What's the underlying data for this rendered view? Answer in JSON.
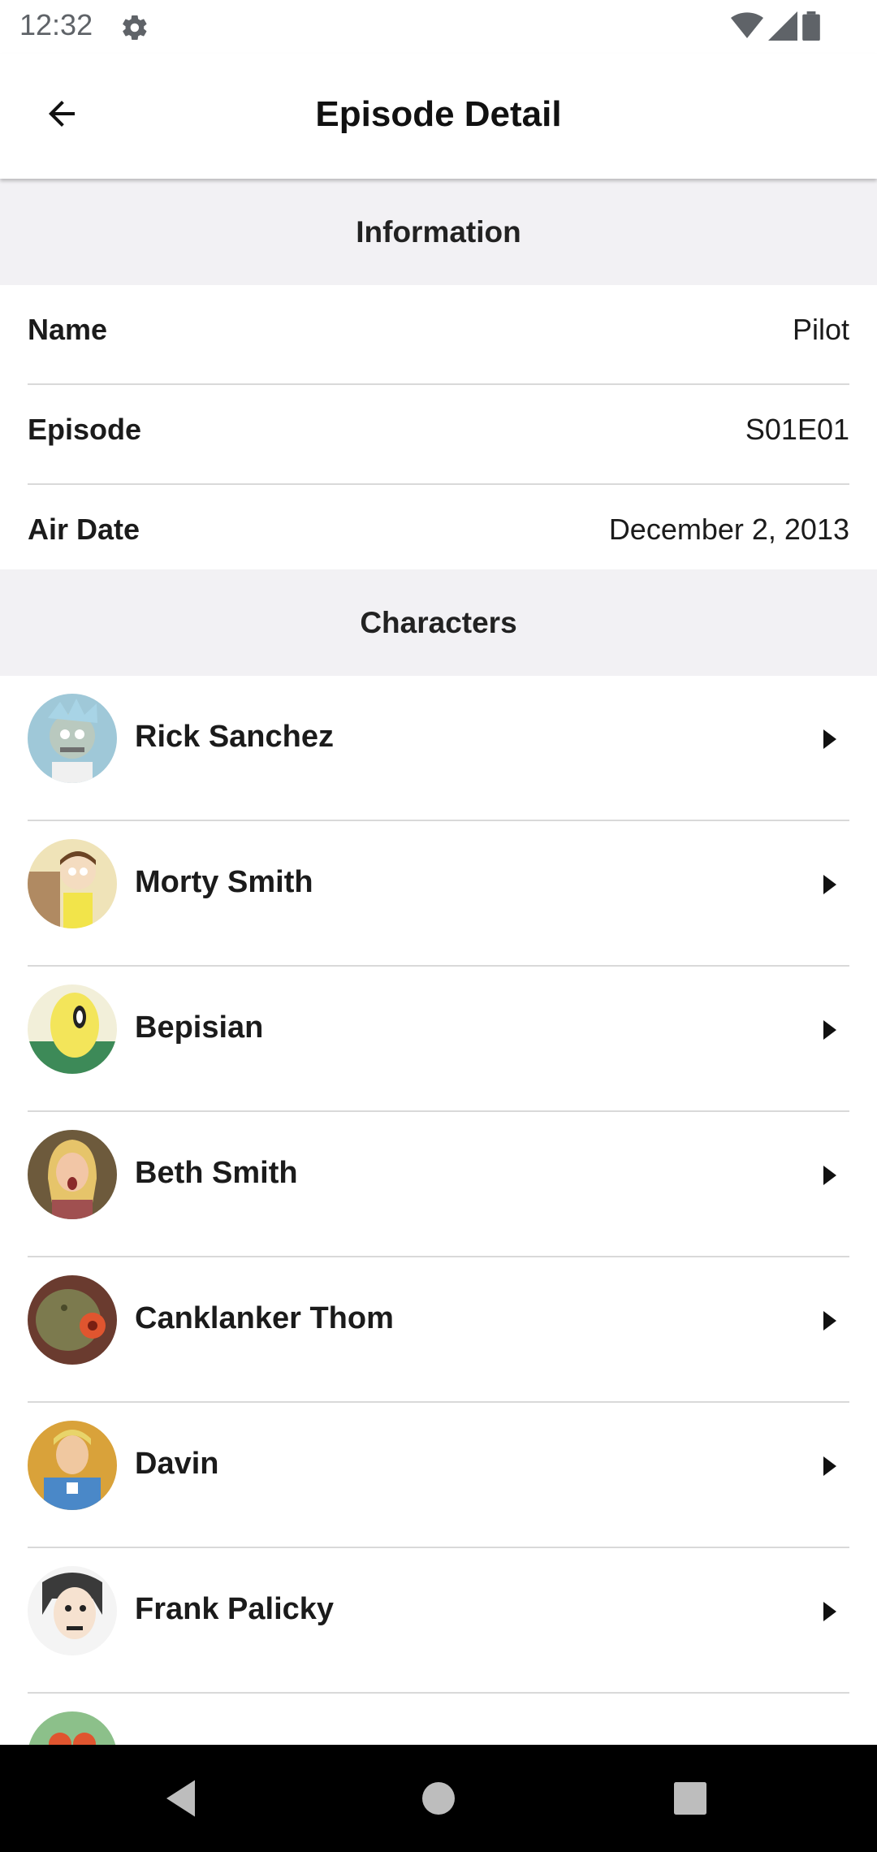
{
  "status": {
    "time": "12:32"
  },
  "appbar": {
    "title": "Episode Detail"
  },
  "info": {
    "header": "Information",
    "rows": [
      {
        "label": "Name",
        "value": "Pilot"
      },
      {
        "label": "Episode",
        "value": "S01E01"
      },
      {
        "label": "Air Date",
        "value": "December 2, 2013"
      }
    ]
  },
  "characters": {
    "header": "Characters",
    "items": [
      {
        "name": "Rick Sanchez",
        "avatar_color": "#9fc8d8"
      },
      {
        "name": "Morty Smith",
        "avatar_color": "#efe3b8"
      },
      {
        "name": "Bepisian",
        "avatar_color": "#f3e55a"
      },
      {
        "name": "Beth Smith",
        "avatar_color": "#6d5a3c"
      },
      {
        "name": "Canklanker Thom",
        "avatar_color": "#6a3b2f"
      },
      {
        "name": "Davin",
        "avatar_color": "#d9a23a"
      },
      {
        "name": "Frank Palicky",
        "avatar_color": "#3a3a3a"
      },
      {
        "name": "",
        "avatar_color": "#8cc08a"
      }
    ]
  }
}
